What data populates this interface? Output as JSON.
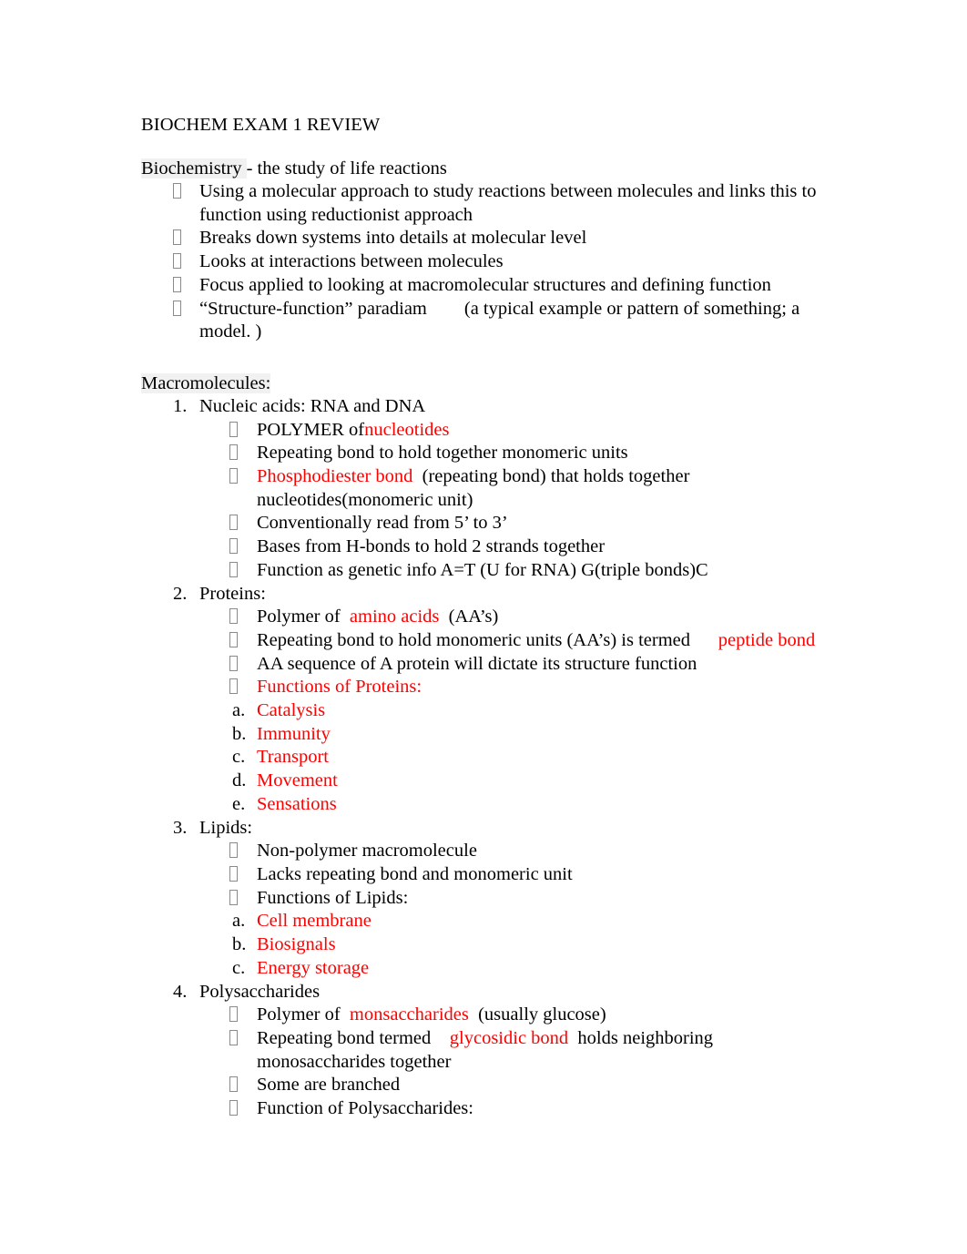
{
  "document": {
    "title": "BIOCHEM EXAM 1 REVIEW",
    "accent_red": "#FF0000",
    "highlight_gray": "#F1F1F1",
    "bullet_glyph": "missing-glyph-box",
    "intro": {
      "term": "Biochemistry ",
      "definition": "- the study of life reactions",
      "bullets": [
        "Using a molecular approach to study reactions between molecules and links this to function using reductionist approach",
        "Breaks down systems into details at molecular level",
        "Looks at interactions between molecules",
        "Focus applied to looking at macromolecular structures and defining function"
      ],
      "paradigm_label": "“Structure-function” paradiam",
      "paradigm_note": "(a typical example or pattern of something; a model. )"
    },
    "macromolecules": {
      "heading": "Macromolecules:",
      "items": [
        {
          "number": "1.",
          "name": "Nucleic acids: RNA and DNA",
          "bullets": [
            {
              "marker": "bullet",
              "pre": "POLYMER of",
              "red": "nucleotides",
              "post": ""
            },
            {
              "marker": "bullet",
              "pre": "Repeating bond to hold together monomeric units",
              "red": "",
              "post": ""
            },
            {
              "marker": "bullet",
              "pre": "",
              "red": "Phosphodiester bond",
              "post": "  (repeating bond) that holds together nucleotides(monomeric unit)"
            },
            {
              "marker": "bullet",
              "pre": "Conventionally read from 5’ to 3’",
              "red": "",
              "post": ""
            },
            {
              "marker": "bullet",
              "pre": "Bases from H-bonds to hold 2 strands together",
              "red": "",
              "post": ""
            },
            {
              "marker": "bullet",
              "pre": "Function as genetic info A=T (U for RNA) G(triple bonds)C",
              "red": "",
              "post": ""
            }
          ],
          "lettered": []
        },
        {
          "number": "2.",
          "name": "Proteins:",
          "bullets": [
            {
              "marker": "bullet",
              "pre": "Polymer of  ",
              "red": "amino acids",
              "post": "  (AA’s)"
            },
            {
              "marker": "bullet",
              "pre": "Repeating bond to hold monomeric units (AA’s) is termed      ",
              "red": "peptide bond",
              "post": ""
            },
            {
              "marker": "bullet",
              "pre": "AA sequence of A protein will dictate its structure function",
              "red": "",
              "post": ""
            },
            {
              "marker": "bullet",
              "pre": "",
              "red": "Functions of Proteins:",
              "post": ""
            }
          ],
          "lettered": [
            {
              "marker": "a.",
              "text": "Catalysis",
              "color": "red"
            },
            {
              "marker": "b.",
              "text": "Immunity",
              "color": "red"
            },
            {
              "marker": "c.",
              "text": "Transport",
              "color": "red"
            },
            {
              "marker": "d.",
              "text": "Movement",
              "color": "red"
            },
            {
              "marker": "e.",
              "text": "Sensations",
              "color": "red"
            }
          ]
        },
        {
          "number": "3.",
          "name": "Lipids:",
          "bullets": [
            {
              "marker": "bullet",
              "pre": "Non-polymer macromolecule",
              "red": "",
              "post": ""
            },
            {
              "marker": "bullet",
              "pre": "Lacks repeating bond and monomeric unit",
              "red": "",
              "post": ""
            },
            {
              "marker": "bullet",
              "pre": "Functions of Lipids:",
              "red": "",
              "post": ""
            }
          ],
          "lettered": [
            {
              "marker": "a.",
              "text": "Cell membrane",
              "color": "red"
            },
            {
              "marker": "b.",
              "text": "Biosignals",
              "color": "red"
            },
            {
              "marker": "c.",
              "text": "Energy storage",
              "color": "red"
            }
          ]
        },
        {
          "number": "4.",
          "name": "Polysaccharides",
          "bullets": [
            {
              "marker": "bullet",
              "pre": "Polymer of  ",
              "red": "monsaccharides",
              "post": "  (usually glucose)"
            },
            {
              "marker": "bullet",
              "pre": "Repeating bond termed    ",
              "red": "glycosidic bond",
              "post": "  holds neighboring monosaccharides together"
            },
            {
              "marker": "bullet",
              "pre": "Some are branched",
              "red": "",
              "post": ""
            },
            {
              "marker": "bullet",
              "pre": "Function of Polysaccharides:",
              "red": "",
              "post": ""
            }
          ],
          "lettered": []
        }
      ]
    }
  }
}
